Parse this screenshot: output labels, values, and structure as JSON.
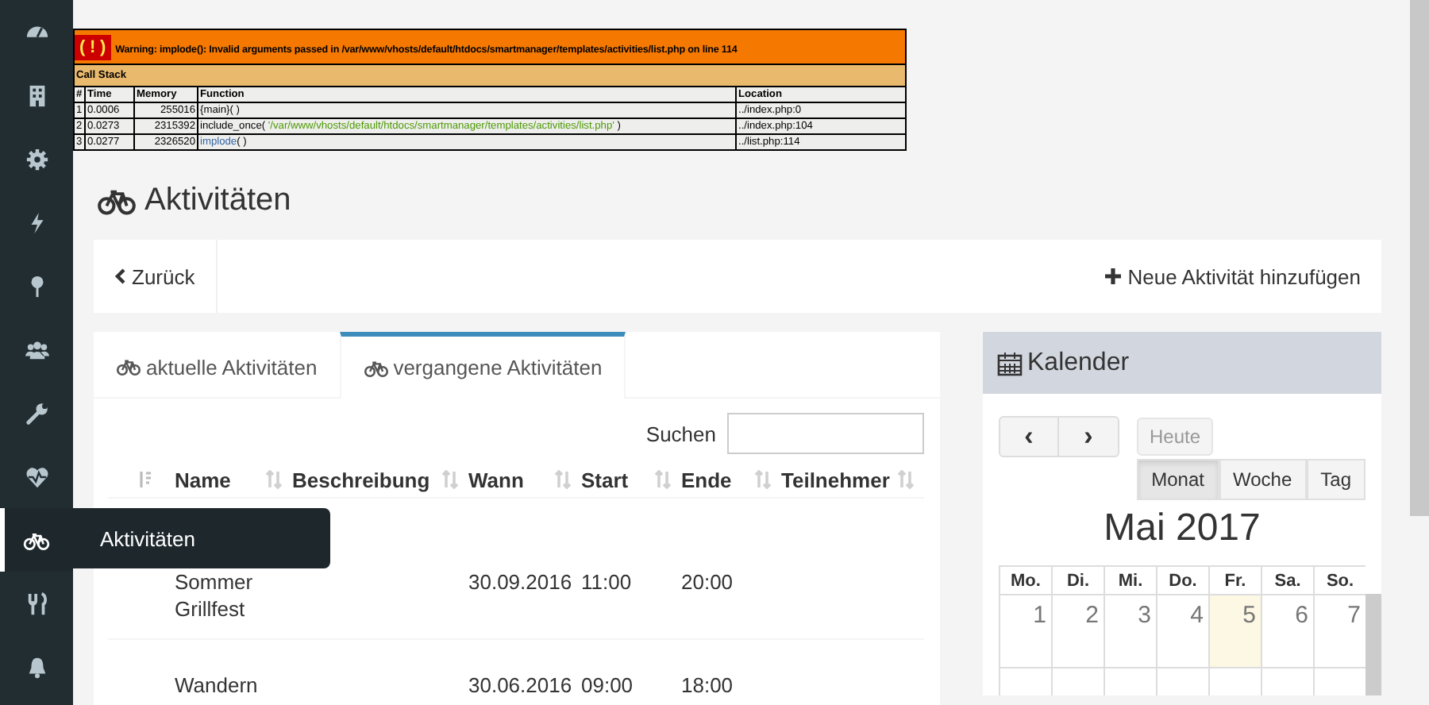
{
  "sidebar": {
    "items": [
      {
        "kind": "dashboard",
        "selected": false
      },
      {
        "kind": "building",
        "selected": false
      },
      {
        "kind": "gear",
        "selected": false
      },
      {
        "kind": "bolt",
        "selected": false
      },
      {
        "kind": "pin",
        "selected": false
      },
      {
        "kind": "users",
        "selected": false
      },
      {
        "kind": "wrench",
        "selected": false
      },
      {
        "kind": "heartbeat",
        "selected": false
      },
      {
        "kind": "bike",
        "selected": true
      },
      {
        "kind": "utensils",
        "selected": false
      },
      {
        "kind": "bell",
        "selected": false
      }
    ],
    "tooltip": "Aktivitäten"
  },
  "error": {
    "badge": "( ! )",
    "message": "Warning: implode(): Invalid arguments passed in /var/www/vhosts/default/htdocs/smartmanager/templates/activities/list.php on line 114",
    "call_stack_label": "Call Stack",
    "columns": [
      "#",
      "Time",
      "Memory",
      "Function",
      "Location"
    ],
    "rows": [
      {
        "index": "1",
        "time": "0.0006",
        "memory": "255016",
        "function": [
          {
            "text": "{main}( )",
            "kind": "plain"
          }
        ],
        "location": "../index.php:0"
      },
      {
        "index": "2",
        "time": "0.0273",
        "memory": "2315392",
        "function": [
          {
            "text": "include_once(",
            "kind": "plain"
          },
          {
            "text": " '/var/www/vhosts/default/htdocs/smartmanager/templates/activities/list.php' ",
            "kind": "string"
          },
          {
            "text": ")",
            "kind": "plain"
          }
        ],
        "location": "../index.php:104"
      },
      {
        "index": "3",
        "time": "0.0277",
        "memory": "2326520",
        "function": [
          {
            "text": "implode",
            "kind": "link"
          },
          {
            "text": "( )",
            "kind": "plain"
          }
        ],
        "location": "../list.php:114"
      }
    ]
  },
  "title": "Aktivitäten",
  "toolbar": {
    "back": "Zurück",
    "add": "Neue Aktivität hinzufügen"
  },
  "activities": {
    "tabs": [
      {
        "label": "aktuelle Aktivitäten",
        "selected": false
      },
      {
        "label": "vergangene Aktivitäten",
        "selected": true
      }
    ],
    "search": {
      "label": "Suchen"
    },
    "columns": [
      "Name",
      "Beschreibung",
      "Wann",
      "Start",
      "Ende",
      "Teilnehmer"
    ],
    "rows": [
      {
        "name": "Sommer Grillfest",
        "description": "",
        "when": "30.09.2016",
        "start": "11:00",
        "end": "20:00",
        "participants": ""
      },
      {
        "name": "Wandern",
        "description": "",
        "when": "30.06.2016",
        "start": "09:00",
        "end": "18:00",
        "participants": ""
      }
    ]
  },
  "calendar": {
    "title": "Kalender",
    "prev": "‹",
    "next": "›",
    "today": "Heute",
    "views": [
      {
        "label": "Monat",
        "selected": true
      },
      {
        "label": "Woche",
        "selected": false
      },
      {
        "label": "Tag",
        "selected": false
      }
    ],
    "month": "Mai 2017",
    "weekdays": [
      "Mo.",
      "Di.",
      "Mi.",
      "Do.",
      "Fr.",
      "Sa.",
      "So."
    ],
    "days": [
      {
        "label": "1",
        "today": false
      },
      {
        "label": "2",
        "today": false
      },
      {
        "label": "3",
        "today": false
      },
      {
        "label": "4",
        "today": false
      },
      {
        "label": "5",
        "today": true
      },
      {
        "label": "6",
        "today": false
      },
      {
        "label": "7",
        "today": false
      }
    ]
  }
}
